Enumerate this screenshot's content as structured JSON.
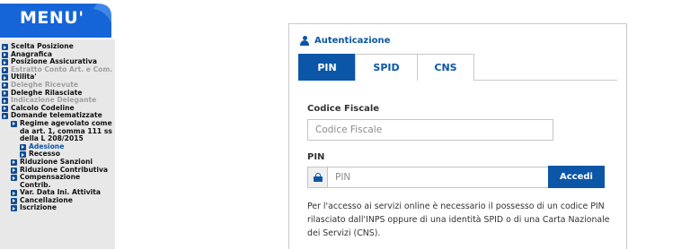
{
  "menu": {
    "title": "MENU'",
    "items": [
      {
        "label": "Scelta Posizione",
        "level": 0,
        "state": "normal"
      },
      {
        "label": "Anagrafica",
        "level": 0,
        "state": "normal"
      },
      {
        "label": "Posizione Assicurativa",
        "level": 0,
        "state": "normal"
      },
      {
        "label": "Estratto Conto Art. e Com.",
        "level": 0,
        "state": "disabled"
      },
      {
        "label": "Utilita'",
        "level": 0,
        "state": "normal"
      },
      {
        "label": "Deleghe Ricevute",
        "level": 0,
        "state": "disabled"
      },
      {
        "label": "Deleghe Rilasciate",
        "level": 0,
        "state": "normal"
      },
      {
        "label": "Indicazione Delegante",
        "level": 0,
        "state": "disabled"
      },
      {
        "label": "Calcolo Codeline",
        "level": 0,
        "state": "normal"
      },
      {
        "label": "Domande telematizzate",
        "level": 0,
        "state": "normal"
      },
      {
        "label": "Regime agevolato come da art. 1, comma 111 ss della L 208/2015",
        "level": 1,
        "state": "normal"
      },
      {
        "label": "Adesione",
        "level": 2,
        "state": "active"
      },
      {
        "label": "Recesso",
        "level": 2,
        "state": "normal"
      },
      {
        "label": "Riduzione Sanzioni",
        "level": 1,
        "state": "normal"
      },
      {
        "label": "Riduzione Contributiva",
        "level": 1,
        "state": "normal"
      },
      {
        "label": "Compensazione Contrib.",
        "level": 1,
        "state": "normal"
      },
      {
        "label": "Var. Data Ini. Attivita",
        "level": 1,
        "state": "normal"
      },
      {
        "label": "Cancellazione",
        "level": 1,
        "state": "normal"
      },
      {
        "label": "Iscrizione",
        "level": 1,
        "state": "normal"
      }
    ]
  },
  "auth": {
    "title": "Autenticazione",
    "tabs": [
      {
        "label": "PIN",
        "active": true
      },
      {
        "label": "SPID",
        "active": false
      },
      {
        "label": "CNS",
        "active": false
      }
    ],
    "codice_fiscale_label": "Codice Fiscale",
    "codice_fiscale_placeholder": "Codice Fiscale",
    "codice_fiscale_value": "",
    "pin_label": "PIN",
    "pin_placeholder": "PIN",
    "pin_value": "",
    "login_button": "Accedi",
    "info_text": "Per l'accesso ai servizi online è necessario il possesso di un codice PIN rilasciato dall'INPS oppure di una identità SPID o di una Carta Nazionale dei Servizi (CNS)."
  },
  "colors": {
    "primary": "#0b56a6",
    "sidebar_bg": "#e8e8e8",
    "menu_banner": "#1565d8"
  }
}
